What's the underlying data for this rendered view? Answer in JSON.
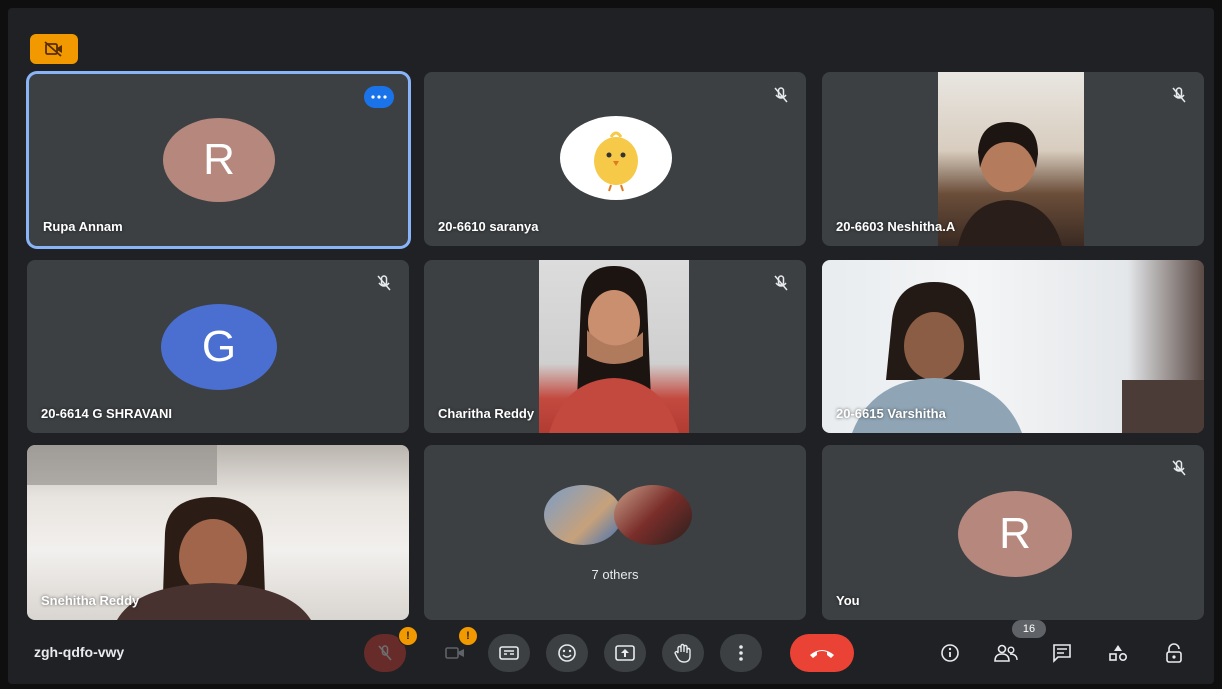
{
  "meeting": {
    "code": "zgh-qdfo-vwy",
    "participant_count": "16"
  },
  "tiles": [
    {
      "name": "Rupa Annam",
      "avatar_letter": "R",
      "avatar_color": "#b5877d",
      "active": true
    },
    {
      "name": "20-6610 saranya",
      "avatar": "chick"
    },
    {
      "name": "20-6603 Neshitha.A",
      "video": true
    },
    {
      "name": "20-6614 G SHRAVANI",
      "avatar_letter": "G",
      "avatar_color": "#4a6fd1"
    },
    {
      "name": "Charitha Reddy",
      "video": true
    },
    {
      "name": "20-6615 Varshitha",
      "video": true
    },
    {
      "name": "Snehitha Reddy",
      "video": true
    },
    {
      "name": "7 others",
      "grouped": true
    },
    {
      "name": "You",
      "avatar_letter": "R",
      "avatar_color": "#b5877d"
    }
  ],
  "controls": {
    "mic_badge": "!",
    "cam_badge": "!",
    "icons": [
      "mic-off-icon",
      "camera-off-icon",
      "captions-icon",
      "emoji-icon",
      "present-icon",
      "raise-hand-icon",
      "more-options-icon",
      "hang-up-icon"
    ],
    "side_icons": [
      "info-icon",
      "people-icon",
      "chat-icon",
      "activities-icon",
      "host-controls-icon"
    ]
  },
  "colors": {
    "accent": "#8ab4f8",
    "hangup": "#ea4335",
    "warning": "#f29900",
    "tile": "#3c4043",
    "background": "#202124"
  }
}
